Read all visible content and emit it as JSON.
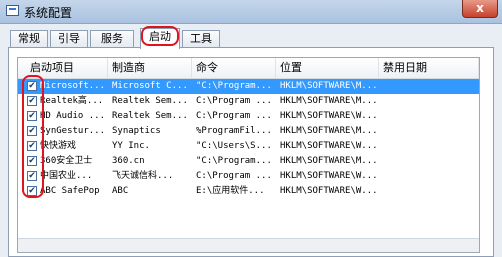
{
  "window": {
    "title": "系统配置",
    "close_label": "x"
  },
  "tabs": [
    {
      "label": "常规"
    },
    {
      "label": "引导"
    },
    {
      "label": "服务"
    },
    {
      "label": "启动",
      "active": true
    },
    {
      "label": "工具"
    }
  ],
  "columns": [
    "启动项目",
    "制造商",
    "命令",
    "位置",
    "禁用日期"
  ],
  "rows": [
    {
      "checked": true,
      "item": "Microsoft...",
      "maker": "Microsoft C...",
      "command": "\"C:\\Program...",
      "location": "HKLM\\SOFTWARE\\M...",
      "date": "",
      "selected": true
    },
    {
      "checked": true,
      "item": "Realtek高...",
      "maker": "Realtek Sem...",
      "command": "C:\\Program ...",
      "location": "HKLM\\SOFTWARE\\M...",
      "date": ""
    },
    {
      "checked": true,
      "item": "HD Audio ...",
      "maker": "Realtek Sem...",
      "command": "C:\\Program ...",
      "location": "HKLM\\SOFTWARE\\W...",
      "date": ""
    },
    {
      "checked": true,
      "item": "SynGestur...",
      "maker": "Synaptics",
      "command": "%ProgramFil...",
      "location": "HKLM\\SOFTWARE\\M...",
      "date": ""
    },
    {
      "checked": true,
      "item": "快快游戏",
      "maker": "YY Inc.",
      "command": "\"C:\\Users\\S...",
      "location": "HKLM\\SOFTWARE\\W...",
      "date": ""
    },
    {
      "checked": true,
      "item": "360安全卫士",
      "maker": "360.cn",
      "command": "\"C:\\Program...",
      "location": "HKLM\\SOFTWARE\\M...",
      "date": ""
    },
    {
      "checked": true,
      "item": "中国农业...",
      "maker": "飞天诚信科...",
      "command": "C:\\Program ...",
      "location": "HKLM\\SOFTWARE\\W...",
      "date": ""
    },
    {
      "checked": true,
      "item": "ABC SafePop",
      "maker": "ABC",
      "command": "E:\\应用软件...",
      "location": "HKLM\\SOFTWARE\\W...",
      "date": ""
    }
  ],
  "colors": {
    "selection": "#3399ff",
    "annotation": "#e0141e"
  }
}
